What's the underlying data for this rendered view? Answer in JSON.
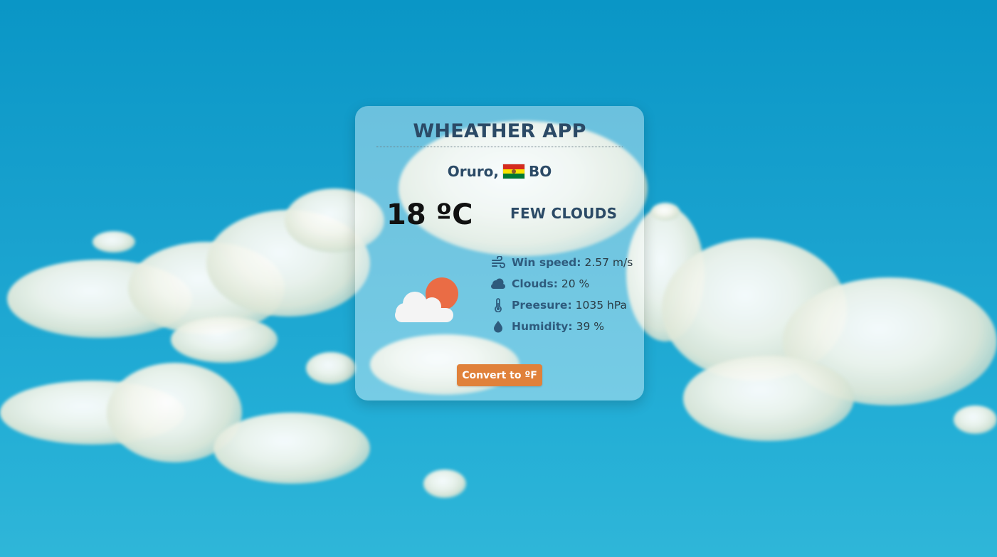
{
  "app": {
    "title": "WHEATHER APP"
  },
  "location": {
    "city": "Oruro,",
    "country_code": "BO",
    "flag_icon": "bolivia-flag-icon"
  },
  "current": {
    "temperature": "18 ºC",
    "description": "FEW CLOUDS",
    "weather_icon": "few-clouds-day-icon"
  },
  "stats": [
    {
      "icon": "wind-icon",
      "label": "Win speed:",
      "value": "2.57 m/s"
    },
    {
      "icon": "cloud-icon",
      "label": "Clouds:",
      "value": "20 %"
    },
    {
      "icon": "thermometer-icon",
      "label": "Preesure:",
      "value": "1035 hPa"
    },
    {
      "icon": "water-drop-icon",
      "label": "Humidity:",
      "value": "39 %"
    }
  ],
  "actions": {
    "convert_label": "Convert to ºF"
  },
  "colors": {
    "accent": "#e0813a",
    "heading": "#2b4a66",
    "label": "#2e5b7d",
    "sun": "#ea6c45"
  }
}
